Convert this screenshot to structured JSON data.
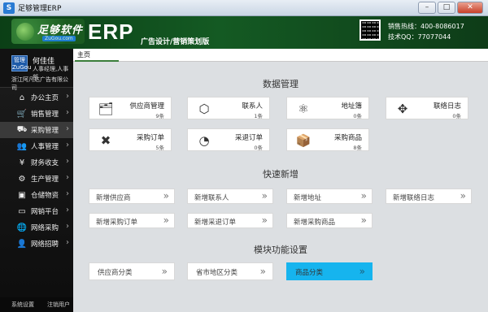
{
  "window": {
    "title": "足够管理ERP",
    "minimize": "–",
    "maximize": "□",
    "close": "✕"
  },
  "header": {
    "logo_text": "足够软件",
    "logo_sub": "ZuGou.com",
    "product": "ERP",
    "edition": "广告设计/营销策划版",
    "hotline": "销售热线：400-8086017",
    "qq": "技术QQ：77077044"
  },
  "user": {
    "avatar_text": "管理 ZuGou",
    "name": "何佳佳",
    "role": "人事经理,人事部",
    "company": "浙江阿凡达广告有限公司"
  },
  "sidebar": {
    "items": [
      {
        "label": "办公主页",
        "icon": "home-icon",
        "glyph": "⌂"
      },
      {
        "label": "销售管理",
        "icon": "cart-icon",
        "glyph": "🛒"
      },
      {
        "label": "采购管理",
        "icon": "purchase-icon",
        "glyph": "⛟"
      },
      {
        "label": "人事管理",
        "icon": "people-icon",
        "glyph": "👥"
      },
      {
        "label": "财务收支",
        "icon": "finance-icon",
        "glyph": "¥"
      },
      {
        "label": "生产管理",
        "icon": "production-icon",
        "glyph": "⚙"
      },
      {
        "label": "仓储物资",
        "icon": "warehouse-icon",
        "glyph": "▣"
      },
      {
        "label": "网销平台",
        "icon": "monitor-icon",
        "glyph": "▭"
      },
      {
        "label": "网络采购",
        "icon": "globe-icon",
        "glyph": "🌐"
      },
      {
        "label": "网络招聘",
        "icon": "recruit-icon",
        "glyph": "👤"
      }
    ],
    "active_index": 2,
    "footer": {
      "settings": "系统设置",
      "logout": "注销用户"
    }
  },
  "tabs": {
    "home": "主页"
  },
  "sections": {
    "data": "数据管理",
    "quick": "快速新增",
    "module": "模块功能设置"
  },
  "data_cards": [
    {
      "label": "供应商管理",
      "count": "9条",
      "icon": "supplier-icon",
      "glyph": "🗂"
    },
    {
      "label": "联系人",
      "count": "1条",
      "icon": "contact-icon",
      "glyph": "⬡"
    },
    {
      "label": "地址簿",
      "count": "0条",
      "icon": "address-book-icon",
      "glyph": "⚛"
    },
    {
      "label": "联络日志",
      "count": "0条",
      "icon": "log-icon",
      "glyph": "✥"
    },
    {
      "label": "采购订单",
      "count": "5条",
      "icon": "order-icon",
      "glyph": "✖"
    },
    {
      "label": "采退订单",
      "count": "0条",
      "icon": "return-order-icon",
      "glyph": "◔"
    },
    {
      "label": "采购商品",
      "count": "8条",
      "icon": "goods-icon",
      "glyph": "📦"
    }
  ],
  "quick_add": [
    {
      "label": "新增供应商"
    },
    {
      "label": "新增联系人"
    },
    {
      "label": "新增地址"
    },
    {
      "label": "新增联络日志"
    },
    {
      "label": "新增采购订单"
    },
    {
      "label": "新增采退订单"
    },
    {
      "label": "新增采购商品"
    }
  ],
  "module_settings": [
    {
      "label": "供应商分类"
    },
    {
      "label": "省市地区分类"
    },
    {
      "label": "商品分类"
    }
  ],
  "arrow": "»",
  "colors": {
    "header_green": "#145a23",
    "active_blue": "#16b4ee",
    "sidebar_black": "#121212"
  }
}
